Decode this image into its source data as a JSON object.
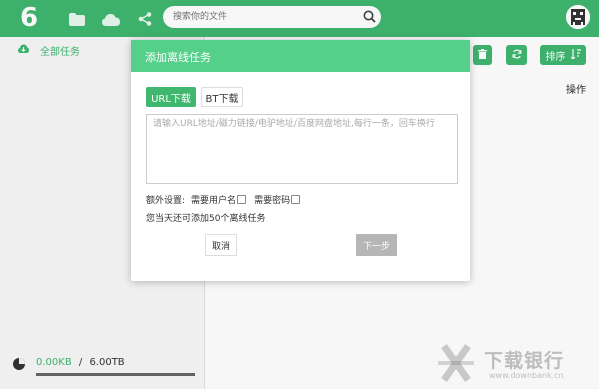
{
  "app": {
    "logo_char": "6",
    "accent_color": "#3fb76f",
    "header_color": "#55d08a"
  },
  "topbar": {
    "nav_icons": [
      "folder-icon",
      "cloud-icon",
      "share-icon"
    ],
    "search": {
      "placeholder": "搜索你的文件"
    }
  },
  "sidebar": {
    "items": [
      {
        "label": "全部任务",
        "icon": "cloud-download-icon"
      }
    ],
    "storage": {
      "used": "0.00KB",
      "separator": "/",
      "total": "6.00TB",
      "used_fraction": 0.0
    }
  },
  "toolbar": {
    "delete_icon": "trash-icon",
    "refresh_icon": "refresh-icon",
    "sort_label": "排序",
    "sort_icon": "sort-icon"
  },
  "table": {
    "operation_header": "操作"
  },
  "dialog": {
    "title": "添加离线任务",
    "tabs": [
      {
        "label": "URL下载",
        "active": true
      },
      {
        "label": "BT下载",
        "active": false
      }
    ],
    "textarea": {
      "placeholder": "请输入URL地址/磁力链接/电驴地址/百度网盘地址,每行一条，回车换行",
      "value": ""
    },
    "extra_label": "额外设置:",
    "need_username_label": "需要用户名",
    "need_password_label": "需要密码",
    "quota_text": "您当天还可添加50个离线任务",
    "cancel_label": "取消",
    "next_label": "下一步"
  },
  "watermark": {
    "text": "下载银行",
    "sub": "www.downbank.cn"
  }
}
